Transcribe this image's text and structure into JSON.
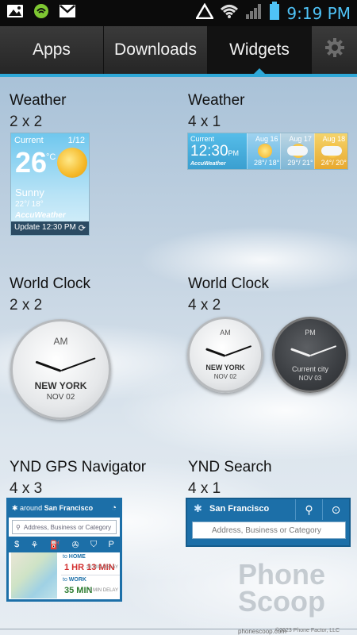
{
  "status_bar": {
    "time": "9:19 PM",
    "icons": [
      "image-icon",
      "circle-app-icon",
      "gmail-icon",
      "alert-triangle-icon",
      "wifi-icon",
      "signal-icon",
      "battery-icon"
    ],
    "accent": "#4fc3f7"
  },
  "tabs": [
    {
      "label": "Apps",
      "active": false
    },
    {
      "label": "Downloads",
      "active": false
    },
    {
      "label": "Widgets",
      "active": true
    }
  ],
  "settings_icon": "gear-icon",
  "accent_color": "#2ea8d8",
  "widgets": {
    "weather_2x2": {
      "name": "Weather",
      "size": "2 x 2",
      "current_label": "Current",
      "date": "1/12",
      "temp": "26",
      "unit": "°C",
      "condition": "Sunny",
      "range": "22°/ 18°",
      "brand": "AccuWeather",
      "update": "Update 12:30 PM"
    },
    "weather_4x1": {
      "name": "Weather",
      "size": "4 x 1",
      "current_label": "Current",
      "time": "12:30",
      "ampm": "PM",
      "brand": "AccuWeather",
      "days": [
        {
          "date": "Aug 16",
          "temps": "28°/ 18°"
        },
        {
          "date": "Aug 17",
          "temps": "29°/ 21°"
        },
        {
          "date": "Aug 18",
          "temps": "24°/ 20°"
        }
      ]
    },
    "world_clock_2x2": {
      "name": "World Clock",
      "size": "2 x 2",
      "ampm": "AM",
      "city": "NEW YORK",
      "date": "NOV 02"
    },
    "world_clock_4x2": {
      "name": "World Clock",
      "size": "4 x 2",
      "clocks": [
        {
          "ampm": "AM",
          "city": "NEW YORK",
          "date": "NOV 02"
        },
        {
          "ampm": "PM",
          "city": "Current city",
          "date": "NOV 03"
        }
      ]
    },
    "ynd_gps": {
      "name": "YND GPS Navigator",
      "size": "4 x 3",
      "around_label": "around",
      "location": "San Francisco",
      "search_placeholder": "Address, Business or Category",
      "icons": [
        "dollar-icon",
        "restaurant-icon",
        "gas-icon",
        "entertainment-icon",
        "shopping-icon",
        "parking-icon"
      ],
      "home_prefix": "to",
      "home_label": "HOME",
      "home_time": "1 HR 13 MIN",
      "home_delay": "28 MIN DELAY",
      "work_prefix": "to",
      "work_label": "WORK",
      "work_time": "35 MIN",
      "work_delay": "5 MIN DELAY"
    },
    "ynd_search": {
      "name": "YND Search",
      "size": "4 x 1",
      "location": "San Francisco",
      "search_placeholder": "Address, Business or Category"
    }
  },
  "footer": {
    "site": "phonescoop.com",
    "copyright": "©2023 Phone Factor, LLC",
    "watermark": "Phone Scoop"
  }
}
